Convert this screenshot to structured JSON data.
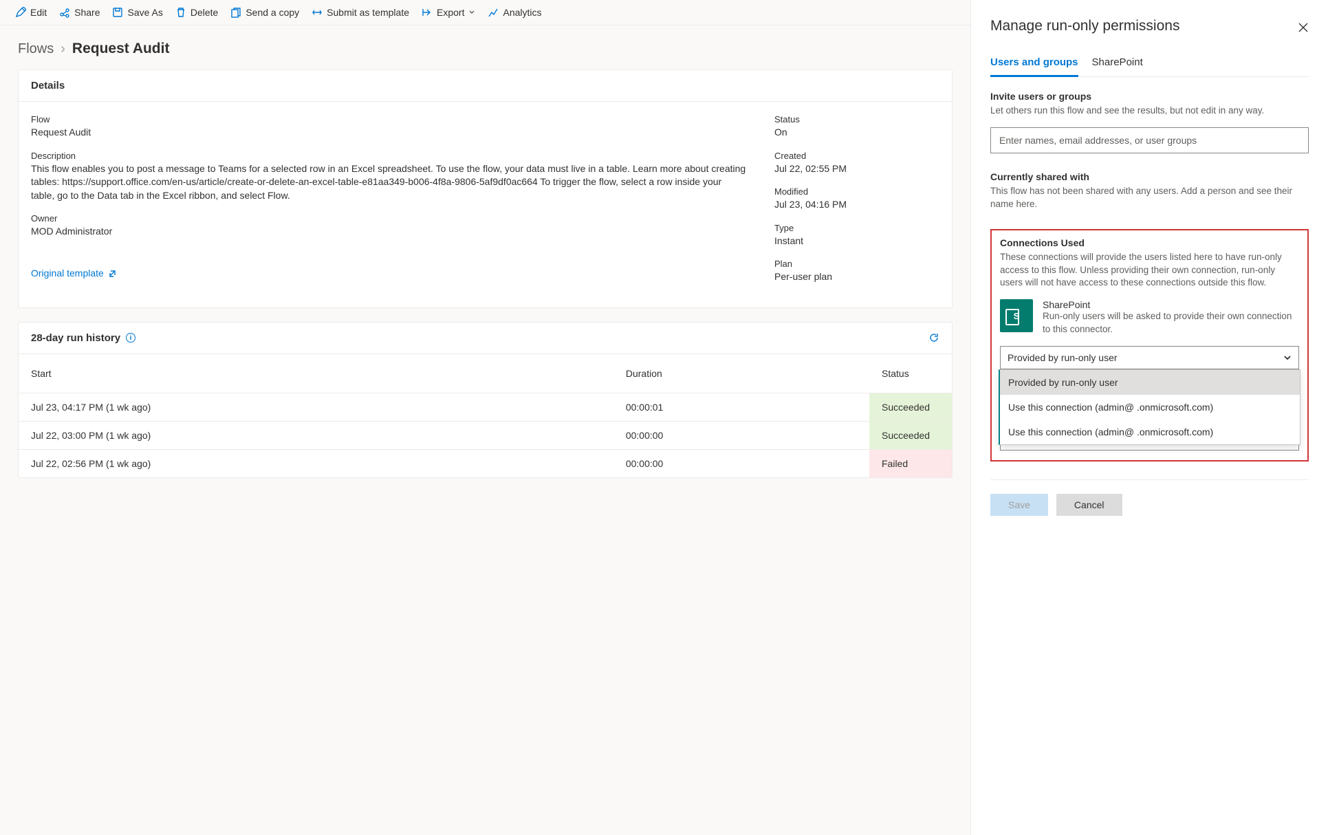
{
  "toolbar": {
    "edit": "Edit",
    "share": "Share",
    "saveAs": "Save As",
    "delete": "Delete",
    "sendCopy": "Send a copy",
    "submitTemplate": "Submit as template",
    "export": "Export",
    "analytics": "Analytics"
  },
  "breadcrumb": {
    "root": "Flows",
    "leaf": "Request Audit"
  },
  "details": {
    "header": "Details",
    "flowLabel": "Flow",
    "flowValue": "Request Audit",
    "descLabel": "Description",
    "descValue": "This flow enables you to post a message to Teams for a selected row in an Excel spreadsheet. To use the flow, your data must live in a table. Learn more about creating tables: https://support.office.com/en-us/article/create-or-delete-an-excel-table-e81aa349-b006-4f8a-9806-5af9df0ac664 To trigger the flow, select a row inside your table, go to the Data tab in the Excel ribbon, and select Flow.",
    "ownerLabel": "Owner",
    "ownerValue": "MOD Administrator",
    "statusLabel": "Status",
    "statusValue": "On",
    "createdLabel": "Created",
    "createdValue": "Jul 22, 02:55 PM",
    "modifiedLabel": "Modified",
    "modifiedValue": "Jul 23, 04:16 PM",
    "typeLabel": "Type",
    "typeValue": "Instant",
    "planLabel": "Plan",
    "planValue": "Per-user plan",
    "templateLink": "Original template"
  },
  "runHistory": {
    "header": "28-day run history",
    "cols": {
      "start": "Start",
      "duration": "Duration",
      "status": "Status"
    },
    "rows": [
      {
        "start": "Jul 23, 04:17 PM (1 wk ago)",
        "duration": "00:00:01",
        "status": "Succeeded",
        "statusClass": "status-succeeded"
      },
      {
        "start": "Jul 22, 03:00 PM (1 wk ago)",
        "duration": "00:00:00",
        "status": "Succeeded",
        "statusClass": "status-succeeded"
      },
      {
        "start": "Jul 22, 02:56 PM (1 wk ago)",
        "duration": "00:00:00",
        "status": "Failed",
        "statusClass": "status-failed"
      }
    ]
  },
  "panel": {
    "title": "Manage run-only permissions",
    "tabs": {
      "users": "Users and groups",
      "sharepoint": "SharePoint"
    },
    "inviteH": "Invite users or groups",
    "inviteP": "Let others run this flow and see the results, but not edit in any way.",
    "inputPlaceholder": "Enter names, email addresses, or user groups",
    "sharedH": "Currently shared with",
    "sharedP": "This flow has not been shared with any users. Add a person and see their name here.",
    "connH": "Connections Used",
    "connP": "These connections will provide the users listed here to have run-only access to this flow. Unless providing their own connection, run-only users will not have access to these connections outside this flow.",
    "connector": {
      "name": "SharePoint",
      "desc": "Run-only users will be asked to provide their own connection to this connector."
    },
    "select1": "Provided by run-only user",
    "select2": "Provided by run-only user",
    "ddOptions": [
      "Provided by run-only user",
      "Use this connection (admin@                      .onmicrosoft.com)",
      "Use this connection (admin@                       .onmicrosoft.com)"
    ],
    "save": "Save",
    "cancel": "Cancel"
  }
}
